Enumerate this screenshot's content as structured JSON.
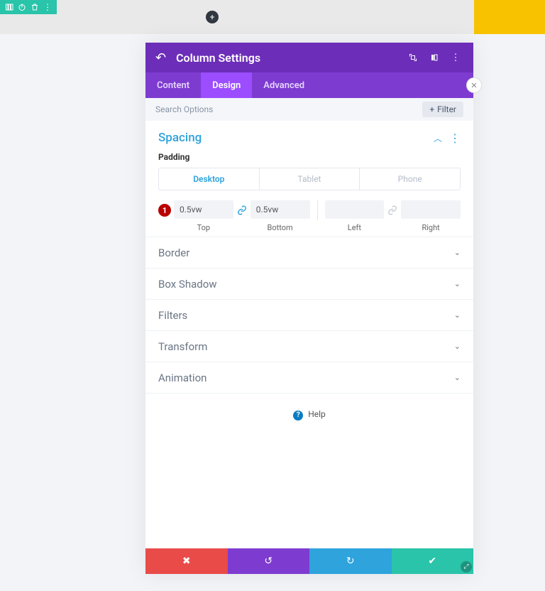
{
  "toolbar": {
    "icons": [
      "columns-icon",
      "power-icon",
      "trash-icon",
      "more-icon"
    ]
  },
  "modal": {
    "title": "Column Settings",
    "tabs": {
      "content": "Content",
      "design": "Design",
      "advanced": "Advanced"
    },
    "search_placeholder": "Search Options",
    "filter_label": "Filter"
  },
  "spacing": {
    "title": "Spacing",
    "padding_label": "Padding",
    "device": {
      "desktop": "Desktop",
      "tablet": "Tablet",
      "phone": "Phone"
    },
    "badge": "1",
    "values": {
      "top": "0.5vw",
      "bottom": "0.5vw",
      "left": "",
      "right": ""
    },
    "labels": {
      "top": "Top",
      "bottom": "Bottom",
      "left": "Left",
      "right": "Right"
    }
  },
  "accordion": [
    "Border",
    "Box Shadow",
    "Filters",
    "Transform",
    "Animation"
  ],
  "help": "Help"
}
